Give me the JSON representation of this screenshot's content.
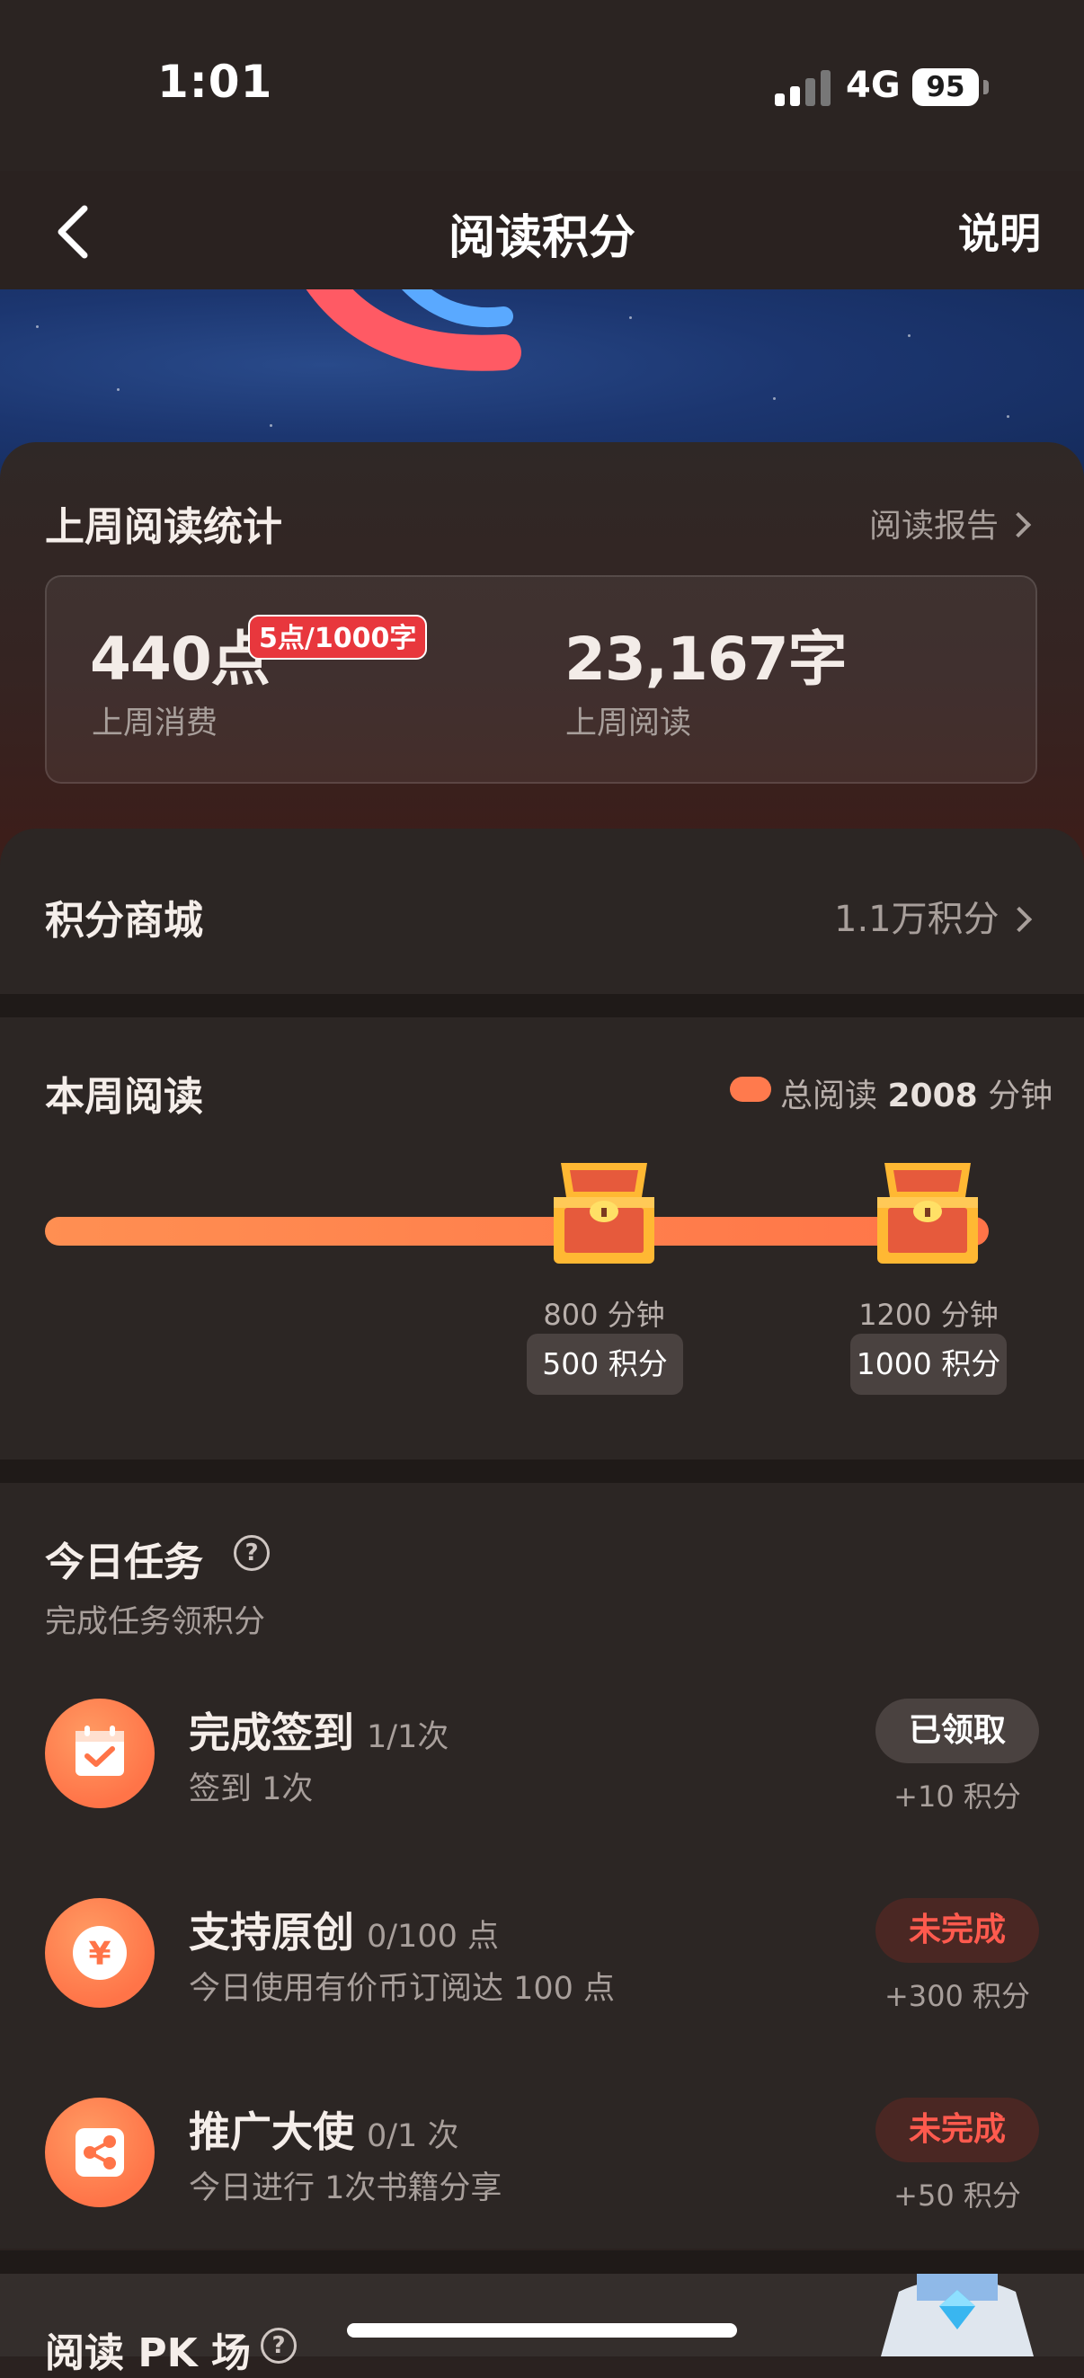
{
  "status_bar": {
    "time": "1:01",
    "network": "4G",
    "battery": "95"
  },
  "nav": {
    "title": "阅读积分",
    "explain_label": "说明"
  },
  "stats": {
    "title": "上周阅读统计",
    "report_link": "阅读报告",
    "consumed_value": "440点",
    "rate_badge": "5点/1000字",
    "consumed_label": "上周消费",
    "read_value": "23,167字",
    "read_label": "上周阅读"
  },
  "mall": {
    "title": "积分商城",
    "points": "1.1万积分"
  },
  "weekly": {
    "title": "本周阅读",
    "legend_prefix": "总阅读",
    "total_minutes": "2008",
    "legend_suffix": "分钟",
    "progress_fraction": 1.0,
    "milestones": [
      {
        "minutes_label": "800 分钟",
        "reward": "500 积分"
      },
      {
        "minutes_label": "1200 分钟",
        "reward": "1000 积分"
      }
    ]
  },
  "tasks": {
    "title": "今日任务",
    "subtitle": "完成任务领积分",
    "items": [
      {
        "icon": "calendar-check-icon",
        "title": "完成签到",
        "count": "1/1次",
        "desc": "签到 1次",
        "button": "已领取",
        "state": "claimed",
        "reward": "+10 积分"
      },
      {
        "icon": "yuan-coin-icon",
        "title": "支持原创",
        "count": "0/100 点",
        "desc": "今日使用有价币订阅达 100 点",
        "button": "未完成",
        "state": "incomplete",
        "reward": "+300 积分"
      },
      {
        "icon": "share-icon",
        "title": "推广大使",
        "count": "0/1 次",
        "desc": "今日进行 1次书籍分享",
        "button": "未完成",
        "state": "incomplete",
        "reward": "+50 积分"
      }
    ]
  },
  "pk": {
    "title": "阅读 PK 场"
  },
  "colors": {
    "accent": "#ff7448",
    "danger": "#ff5a4e",
    "background": "#2c2624",
    "banner": "#1c3670"
  }
}
